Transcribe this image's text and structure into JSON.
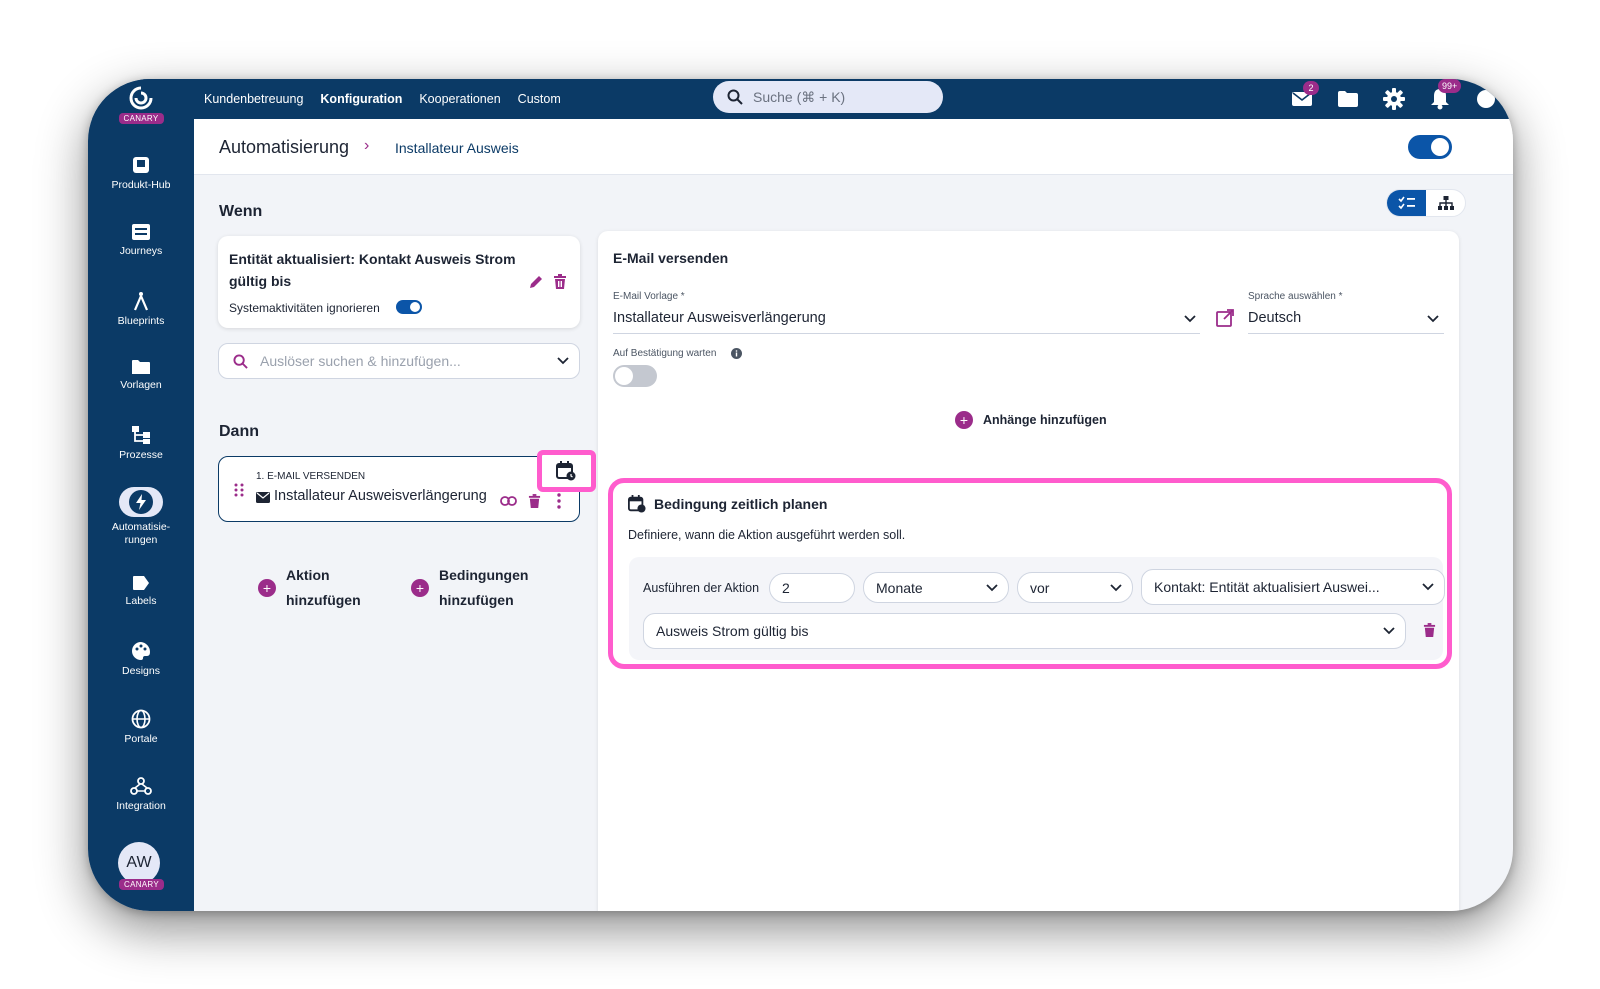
{
  "brand": {
    "badge": "CANARY"
  },
  "topnav": [
    {
      "label": "Kundenbetreuung",
      "active": false
    },
    {
      "label": "Konfiguration",
      "active": true
    },
    {
      "label": "Kooperationen",
      "active": false
    },
    {
      "label": "Custom",
      "active": false
    }
  ],
  "search": {
    "placeholder": "Suche (⌘ + K)"
  },
  "topicons": {
    "mail_badge": "2",
    "notifications_badge": "99+"
  },
  "sidebar": {
    "items": [
      {
        "label": "Produkt-Hub",
        "icon": "product-hub-icon"
      },
      {
        "label": "Journeys",
        "icon": "journeys-icon"
      },
      {
        "label": "Blueprints",
        "icon": "blueprints-icon"
      },
      {
        "label": "Vorlagen",
        "icon": "folder-icon"
      },
      {
        "label": "Prozesse",
        "icon": "processes-icon"
      },
      {
        "label": "Automatisie-\nrungen",
        "icon": "lightning-icon",
        "active": true
      },
      {
        "label": "Labels",
        "icon": "label-icon"
      },
      {
        "label": "Designs",
        "icon": "palette-icon"
      },
      {
        "label": "Portale",
        "icon": "globe-icon"
      },
      {
        "label": "Integration",
        "icon": "integration-icon"
      }
    ],
    "user": {
      "initials": "AW",
      "badge": "CANARY"
    }
  },
  "breadcrumb": {
    "root": "Automatisierung",
    "separator": "›",
    "current": "Installateur Ausweis"
  },
  "main": {
    "wenn": "Wenn",
    "dann": "Dann",
    "trigger": {
      "title": "Entität aktualisiert: Kontakt Ausweis Strom gültig bis",
      "ignore_label": "Systemaktivitäten ignorieren"
    },
    "trigger_search": {
      "placeholder": "Auslöser suchen & hinzufügen..."
    },
    "step": {
      "index_label": "1. E-MAIL VERSENDEN",
      "name": "Installateur Ausweisverlängerung"
    },
    "add_action": {
      "line1": "Aktion",
      "line2": "hinzufügen"
    },
    "add_condition": {
      "line1": "Bedingungen",
      "line2": "hinzufügen"
    }
  },
  "email_panel": {
    "title": "E-Mail versenden",
    "template_label": "E-Mail Vorlage *",
    "template_value": "Installateur Ausweisverlängerung",
    "language_label": "Sprache auswählen *",
    "language_value": "Deutsch",
    "confirm_label": "Auf Bestätigung warten",
    "attachments": "Anhänge hinzufügen"
  },
  "schedule": {
    "title": "Bedingung zeitlich planen",
    "description": "Definiere, wann die Aktion ausgeführt werden soll.",
    "run_label": "Ausführen der Aktion",
    "amount": "2",
    "unit": "Monate",
    "direction": "vor",
    "reference": "Kontakt: Entität aktualisiert Auswei...",
    "attribute": "Ausweis Strom gültig bis"
  },
  "colors": {
    "navy": "#0b3a66",
    "accent": "#9b2c8a",
    "blue": "#0b55a8",
    "highlight": "#ff5ccd"
  }
}
